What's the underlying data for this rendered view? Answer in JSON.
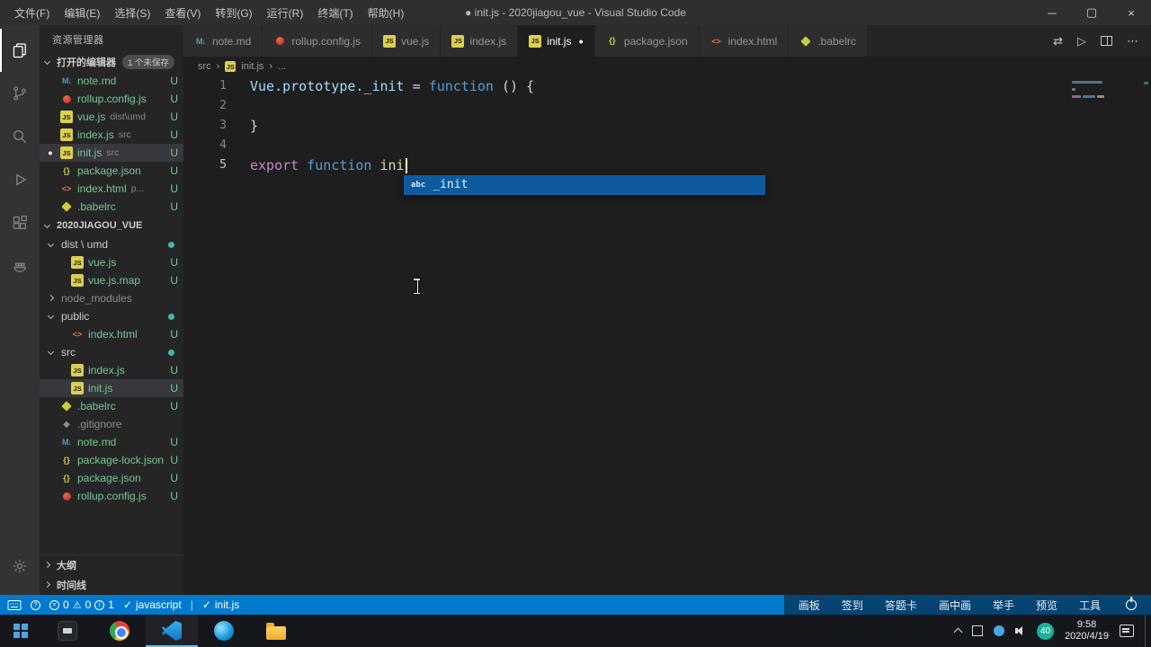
{
  "icons": {
    "minimize": "─",
    "maximize": "▢",
    "close": "×",
    "dirty_dot": "●",
    "check": "✓",
    "swap": "⇄",
    "run": "▷",
    "more": "⋯",
    "crumb_sep": "›",
    "question": "?",
    "error_x": "×",
    "info_i": "i",
    "warning": "⚠"
  },
  "titlebar": {
    "menus": [
      "文件(F)",
      "编辑(E)",
      "选择(S)",
      "查看(V)",
      "转到(G)",
      "运行(R)",
      "终端(T)",
      "帮助(H)"
    ],
    "title": "● init.js - 2020jiagou_vue - Visual Studio Code"
  },
  "activity_bar": {
    "items": [
      "explorer",
      "source-control",
      "search",
      "run-debug",
      "extensions",
      "docker"
    ],
    "bottom": [
      "settings"
    ]
  },
  "sidebar": {
    "header": "资源管理器",
    "open_editors": {
      "label": "打开的编辑器",
      "badge": "1 个未保存",
      "items": [
        {
          "name": "note.md",
          "desc": "",
          "status": "U"
        },
        {
          "name": "rollup.config.js",
          "desc": "",
          "status": "U"
        },
        {
          "name": "vue.js",
          "desc": "dist\\umd",
          "status": "U"
        },
        {
          "name": "index.js",
          "desc": "src",
          "status": "U"
        },
        {
          "name": "init.js",
          "desc": "src",
          "status": "U"
        },
        {
          "name": "package.json",
          "desc": "",
          "status": "U"
        },
        {
          "name": "index.html",
          "desc": "p...",
          "status": "U"
        },
        {
          "name": ".babelrc",
          "desc": "",
          "status": "U"
        }
      ]
    },
    "tree": {
      "root": "2020JIAGOU_VUE",
      "items": [
        {
          "name": "dist \\ umd"
        },
        {
          "name": "vue.js",
          "status": "U"
        },
        {
          "name": "vue.js.map",
          "status": "U"
        },
        {
          "name": "node_modules"
        },
        {
          "name": "public"
        },
        {
          "name": "index.html",
          "status": "U"
        },
        {
          "name": "src"
        },
        {
          "name": "index.js",
          "status": "U"
        },
        {
          "name": "init.js",
          "status": "U"
        },
        {
          "name": ".babelrc",
          "status": "U"
        },
        {
          "name": ".gitignore"
        },
        {
          "name": "note.md",
          "status": "U"
        },
        {
          "name": "package-lock.json",
          "status": "U"
        },
        {
          "name": "package.json",
          "status": "U"
        },
        {
          "name": "rollup.config.js",
          "status": "U"
        }
      ]
    },
    "bottom": {
      "outline": "大纲",
      "timeline": "时间线"
    }
  },
  "tabs": {
    "items": [
      {
        "label": "note.md"
      },
      {
        "label": "rollup.config.js"
      },
      {
        "label": "vue.js"
      },
      {
        "label": "index.js"
      },
      {
        "label": "init.js"
      },
      {
        "label": "package.json"
      },
      {
        "label": "index.html"
      },
      {
        "label": ".babelrc"
      }
    ]
  },
  "breadcrumbs": {
    "items": [
      "src",
      "init.js",
      "..."
    ]
  },
  "editor": {
    "lines": [
      {
        "num": "1",
        "tokens": [
          {
            "text": "Vue.prototype._init"
          },
          {
            "text": " = "
          },
          {
            "text": "function"
          },
          {
            "text": " () {"
          }
        ]
      },
      {
        "num": "2",
        "tokens": []
      },
      {
        "num": "3",
        "tokens": [
          {
            "text": "}"
          }
        ]
      },
      {
        "num": "4",
        "tokens": []
      },
      {
        "num": "5",
        "tokens": [
          {
            "text": "export"
          },
          {
            "text": " "
          },
          {
            "text": "function"
          },
          {
            "text": " "
          },
          {
            "text": "ini"
          }
        ]
      }
    ],
    "suggest": {
      "kind": "abc",
      "label": "_init"
    }
  },
  "statusbar": {
    "errors": "0",
    "warnings": "0",
    "infos": "1",
    "lang": "javascript",
    "file": "init.js",
    "sep": "|",
    "overlay": [
      "画板",
      "签到",
      "答题卡",
      "画中画",
      "举手",
      "预览",
      "工具"
    ]
  },
  "taskbar": {
    "time": "9:58",
    "date": "2020/4/19",
    "badge": "40"
  }
}
